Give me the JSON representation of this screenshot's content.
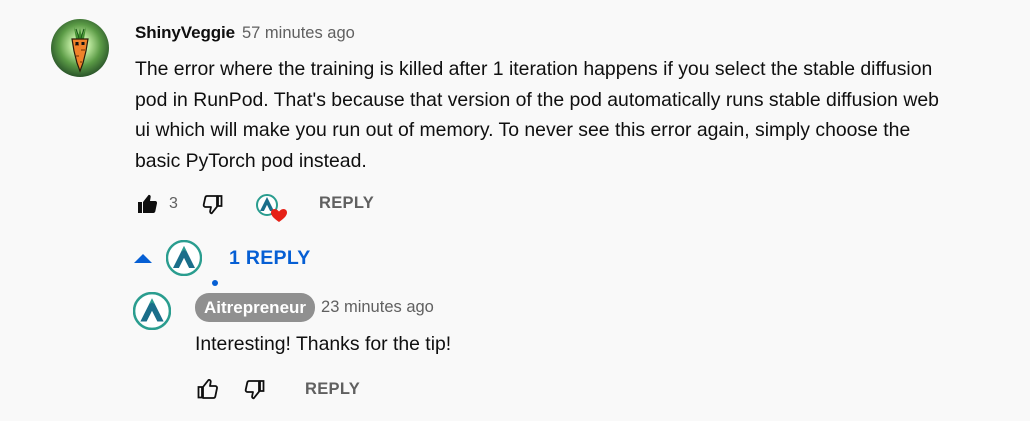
{
  "comment": {
    "author": "ShinyVeggie",
    "timestamp": "57 minutes ago",
    "avatar_icon": "carrot-avatar",
    "lines": [
      "The error where the training is killed after 1 iteration happens if you select the stable diffusion",
      "pod in RunPod. That's because that version of the pod automatically runs stable diffusion web",
      "ui which will make you run out of memory. To never see this error again, simply choose the",
      "basic PyTorch pod instead."
    ],
    "like_count": "3",
    "liked": true,
    "creator_hearted": true,
    "reply_label": "REPLY"
  },
  "replies_toggle": {
    "label": "1 REPLY",
    "expanded": true
  },
  "reply": {
    "author": "Aitrepreneur",
    "timestamp": "23 minutes ago",
    "text": "Interesting! Thanks for the tip!",
    "reply_label": "REPLY",
    "is_channel_owner": true
  },
  "colors": {
    "background": "#f9f9f9",
    "text": "#0f0f0f",
    "secondary_text": "#606060",
    "accent_blue": "#065fd4",
    "heart_red": "#e62117",
    "owner_chip": "#909090",
    "logo_teal": "#2a9d8f"
  }
}
